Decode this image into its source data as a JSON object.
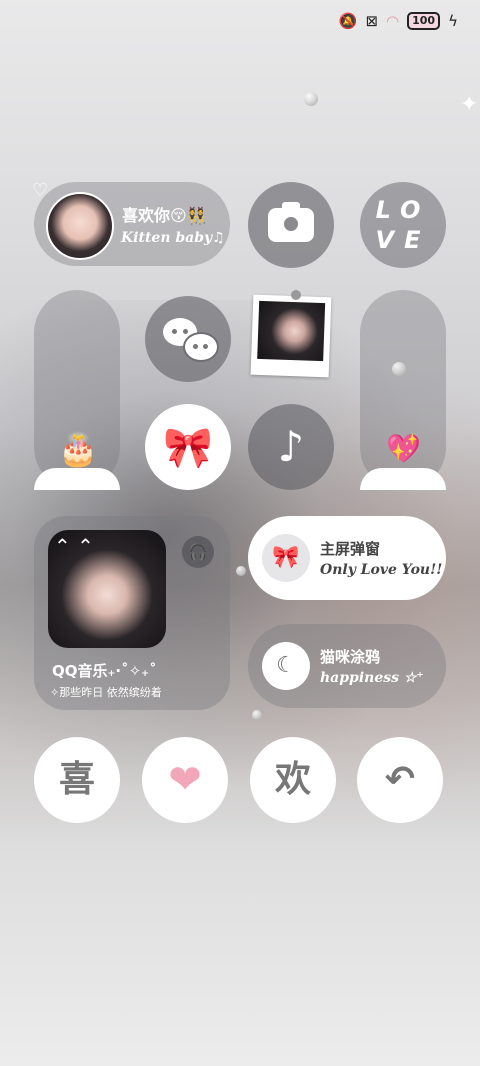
{
  "status_bar": {
    "icons": [
      "bell-muted-icon",
      "sim-off-icon",
      "wifi-icon"
    ],
    "battery": "100"
  },
  "contact_widget": {
    "name": "喜欢你😚👯",
    "subtitle": "Kitten baby♫"
  },
  "love_widget": {
    "line1": "LO",
    "line2": "VE"
  },
  "music_widget": {
    "title": "QQ音乐₊·˚✧₊˚",
    "lyric": "✧那些昨日 依然缤纷着"
  },
  "popup_widget": {
    "title": "主屏弹窗",
    "subtitle": "Only Love You!!"
  },
  "doodle_widget": {
    "title": "猫咪涂鸦",
    "subtitle": "happiness ☆⁺"
  },
  "dock": {
    "item1": "喜",
    "item3": "欢"
  },
  "colors": {
    "pink_accent": "#f2a7b8",
    "widget_gray": "#7a7a7f",
    "white": "#ffffff"
  }
}
